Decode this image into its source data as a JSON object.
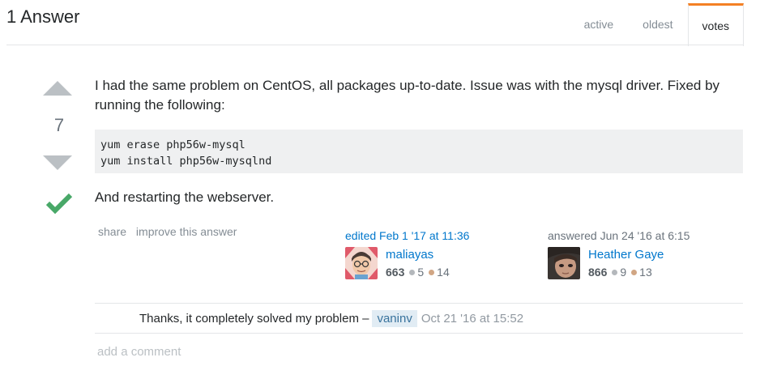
{
  "header": {
    "answer_count": "1 Answer",
    "tabs": [
      {
        "label": "active"
      },
      {
        "label": "oldest"
      },
      {
        "label": "votes"
      }
    ],
    "selected_tab": "votes"
  },
  "answer": {
    "score": "7",
    "accepted": true,
    "paragraph_1": "I had the same problem on CentOS, all packages up-to-date. Issue was with the mysql driver. Fixed by running the following:",
    "code_lines": [
      "yum erase php56w-mysql",
      "yum install php56w-mysqlnd"
    ],
    "paragraph_2": "And restarting the webserver.",
    "menu": {
      "share": "share",
      "improve": "improve this answer"
    },
    "editor": {
      "action": "edited Feb 1 '17 at 11:36",
      "name": "maliayas",
      "reputation": "663",
      "silver": "5",
      "bronze": "14"
    },
    "author": {
      "action": "answered Jun 24 '16 at 6:15",
      "name": "Heather Gaye",
      "reputation": "866",
      "silver": "9",
      "bronze": "13"
    }
  },
  "comments": [
    {
      "text": "Thanks, it completely solved my problem –",
      "user": "vaninv",
      "date": "Oct 21 '16 at 15:52"
    }
  ],
  "add_comment_label": "add a comment",
  "colors": {
    "accent": "#f48024",
    "link": "#0077cc",
    "accepted": "#48a868",
    "vote_arrow": "#bbc0c4"
  },
  "icons": [
    "upvote-arrow-icon",
    "downvote-arrow-icon",
    "accepted-check-icon"
  ]
}
